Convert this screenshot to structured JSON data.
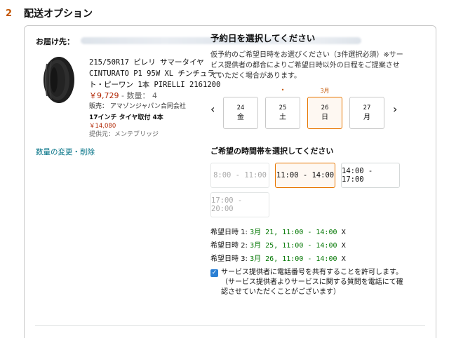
{
  "section": {
    "number": "2",
    "title": "配送オプション"
  },
  "shipping": {
    "label": "お届け先："
  },
  "product": {
    "title_lines": [
      "215/50R17 ピレリ サマータイヤ",
      "CINTURATO P1 95W XL チンチュラー",
      "ト・ピーワン 1本 PIRELLI 2161200"
    ],
    "price": "￥9,729",
    "quantity_text": "- 数量： 4",
    "seller": "販売： アマゾンジャパン合同会社",
    "service_name": "17インチ タイヤ取付 4本",
    "service_price": "￥14,080",
    "provider": "提供元：メンテブリッジ",
    "change_link": "数量の変更・削除"
  },
  "reservation": {
    "heading": "予約日を選択してください",
    "note": "仮予約のご希望日時をお選びください（3件選択必須）※サービス提供者の都合によりご希望日時以外の日程をご提案させていただく場合があります。",
    "month_label": "3月",
    "dot": "•",
    "prev_icon": "‹",
    "next_icon": "›",
    "days": [
      {
        "num": "24",
        "weekday": "金"
      },
      {
        "num": "25",
        "weekday": "土"
      },
      {
        "num": "26",
        "weekday": "日"
      },
      {
        "num": "27",
        "weekday": "月"
      }
    ]
  },
  "time": {
    "heading": "ご希望の時間帯を選択してください",
    "slots": [
      "8:00 - 11:00",
      "11:00 - 14:00",
      "14:00 - 17:00",
      "17:00 - 20:00"
    ]
  },
  "preferences": [
    {
      "label": "希望日時 1:",
      "value": "3月 21, 11:00 - 14:00",
      "remove": "X"
    },
    {
      "label": "希望日時 2:",
      "value": "3月 25, 11:00 - 14:00",
      "remove": "X"
    },
    {
      "label": "希望日時 3:",
      "value": "3月 26, 11:00 - 14:00",
      "remove": "X"
    }
  ],
  "consent": {
    "checkmark": "✓",
    "text": "サービス提供者に電話番号を共有することを許可します。（サービス提供者よりサービスに関する質問を電話にて確認させていただくことがございます）"
  },
  "colors": {
    "accent": "#c45500",
    "selected_border": "#e77600",
    "link": "#007185",
    "price": "#b12704",
    "green": "#007600"
  }
}
